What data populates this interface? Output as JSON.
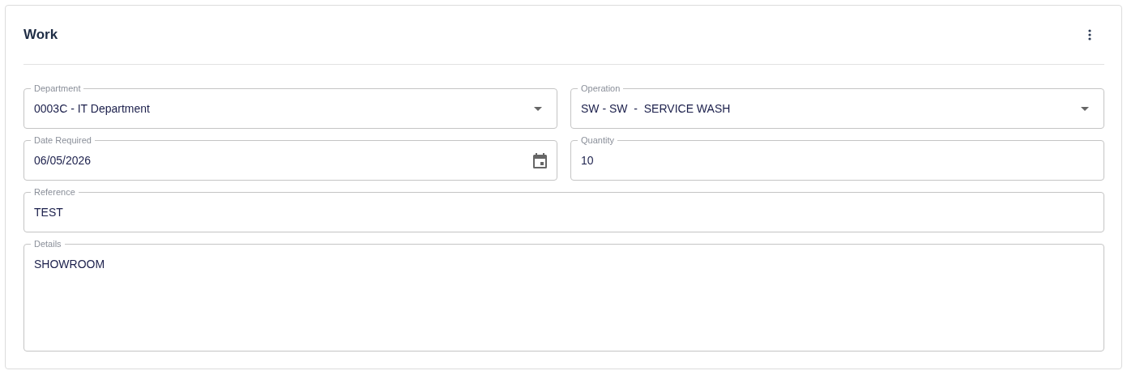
{
  "card": {
    "title": "Work"
  },
  "fields": [
    {
      "kind": "select",
      "label": "Department",
      "value": "0003C - IT Department",
      "wide": false
    },
    {
      "kind": "select",
      "label": "Operation",
      "value": "SW - SW  -  SERVICE WASH",
      "wide": false
    },
    {
      "kind": "date",
      "label": "Date Required",
      "value": "06/05/2026",
      "wide": false
    },
    {
      "kind": "text",
      "label": "Quantity",
      "value": "10",
      "wide": false
    },
    {
      "kind": "text",
      "label": "Reference",
      "value": "TEST",
      "wide": true
    },
    {
      "kind": "textarea",
      "label": "Details",
      "value": "SHOWROOM",
      "wide": true
    }
  ]
}
